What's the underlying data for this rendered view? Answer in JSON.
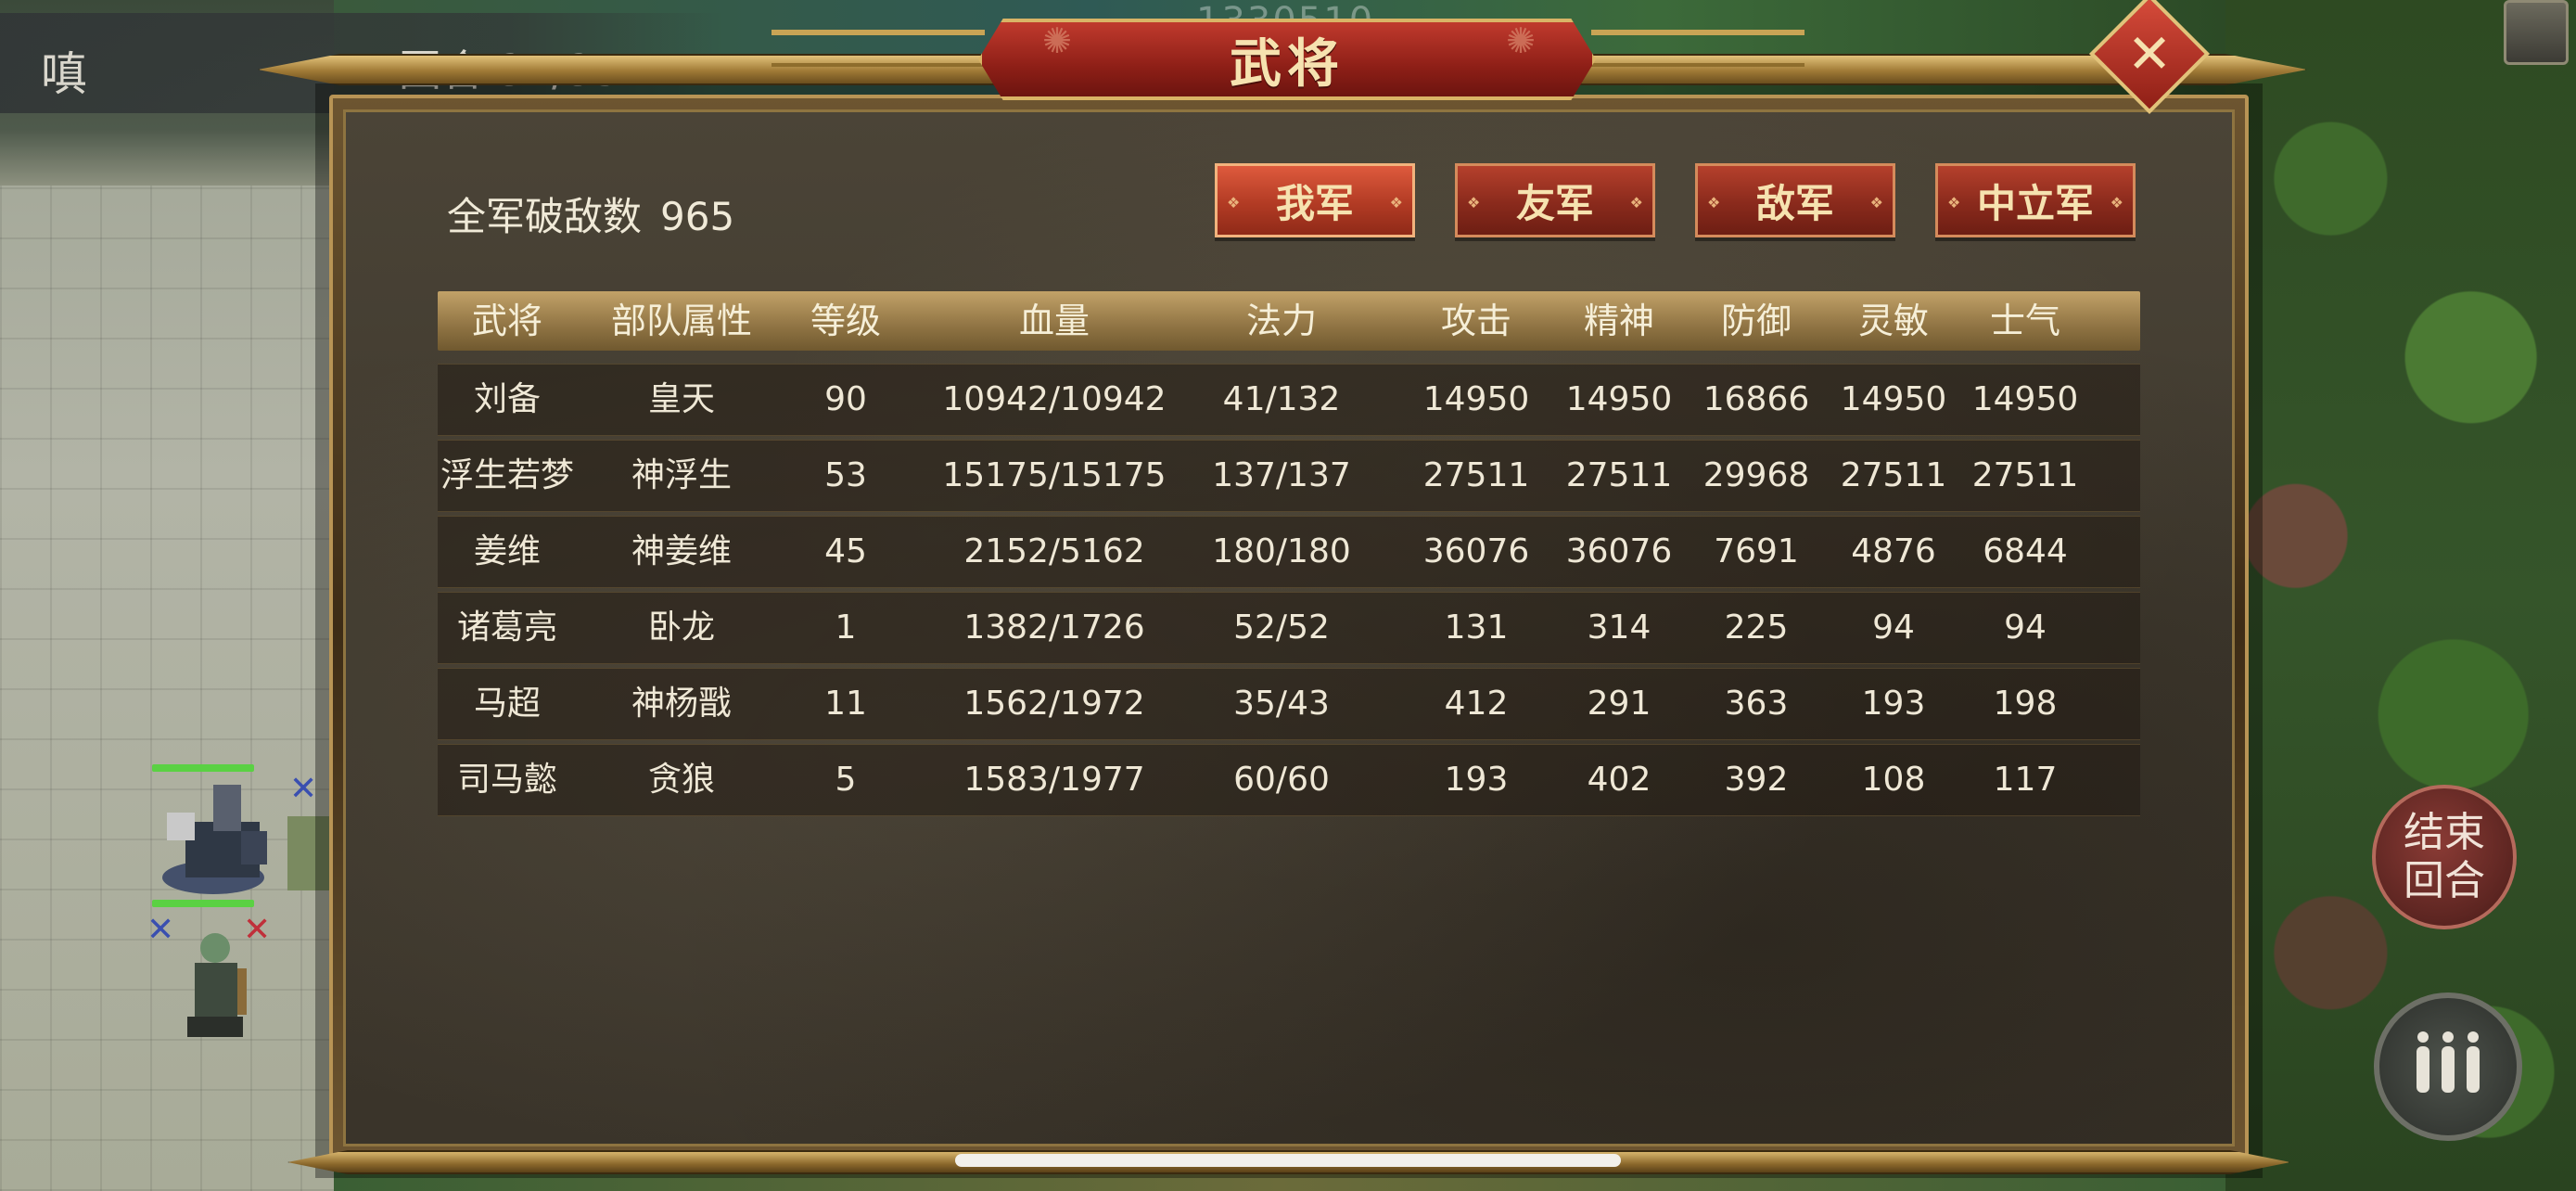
{
  "hud": {
    "glyph": "嗔",
    "round_text": "回合  34/35",
    "top_score": "1330510",
    "end_turn_label": "结束回合"
  },
  "dialog": {
    "title": "武将",
    "kill_label": "全军破敌数",
    "kill_value": "965",
    "tabs": [
      {
        "label": "我军",
        "active": true
      },
      {
        "label": "友军",
        "active": false
      },
      {
        "label": "敌军",
        "active": false
      },
      {
        "label": "中立军",
        "active": false
      }
    ],
    "columns": [
      "武将",
      "部队属性",
      "等级",
      "血量",
      "法力",
      "攻击",
      "精神",
      "防御",
      "灵敏",
      "士气"
    ],
    "rows": [
      [
        "刘备",
        "皇天",
        "90",
        "10942/10942",
        "41/132",
        "14950",
        "14950",
        "16866",
        "14950",
        "14950"
      ],
      [
        "浮生若梦",
        "神浮生",
        "53",
        "15175/15175",
        "137/137",
        "27511",
        "27511",
        "29968",
        "27511",
        "27511"
      ],
      [
        "姜维",
        "神姜维",
        "45",
        "2152/5162",
        "180/180",
        "36076",
        "36076",
        "7691",
        "4876",
        "6844"
      ],
      [
        "诸葛亮",
        "卧龙",
        "1",
        "1382/1726",
        "52/52",
        "131",
        "314",
        "225",
        "94",
        "94"
      ],
      [
        "马超",
        "神杨戬",
        "11",
        "1562/1972",
        "35/43",
        "412",
        "291",
        "363",
        "193",
        "198"
      ],
      [
        "司马懿",
        "贪狼",
        "5",
        "1583/1977",
        "60/60",
        "193",
        "402",
        "392",
        "108",
        "117"
      ]
    ]
  },
  "colors": {
    "tab_red": "#8a2a1c",
    "title_red": "#8e1f17",
    "gold": "#c9a455"
  }
}
